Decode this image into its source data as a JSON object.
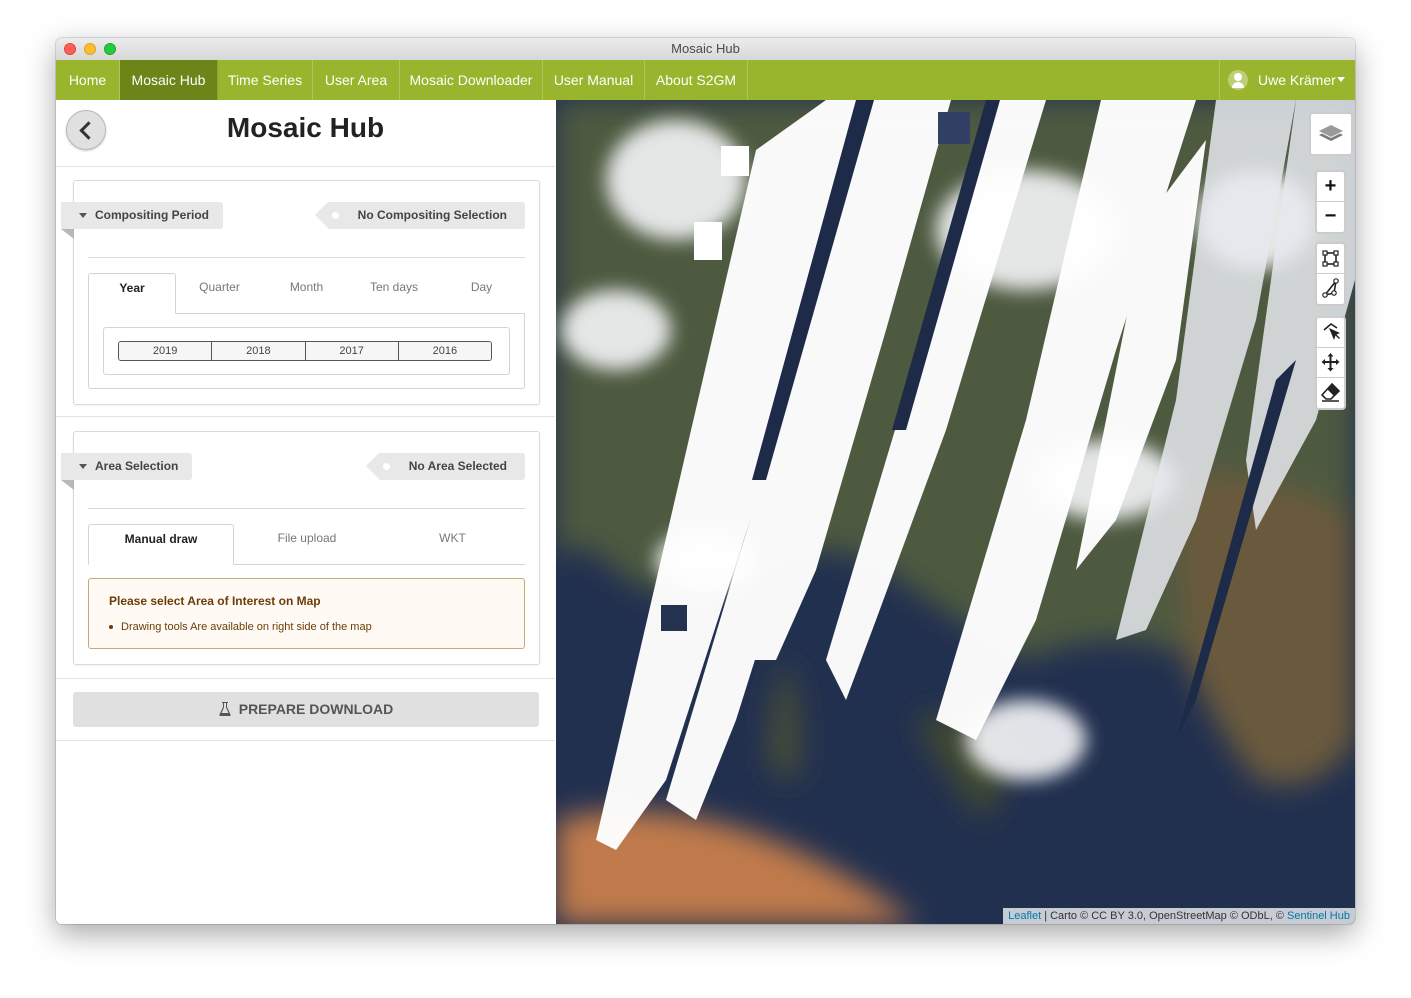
{
  "window": {
    "title": "Mosaic Hub"
  },
  "nav": {
    "items": [
      {
        "label": "Home",
        "active": false
      },
      {
        "label": "Mosaic Hub",
        "active": true
      },
      {
        "label": "Time Series",
        "active": false
      },
      {
        "label": "User Area",
        "active": false
      },
      {
        "label": "Mosaic Downloader",
        "active": false
      },
      {
        "label": "User Manual",
        "active": false
      },
      {
        "label": "About S2GM",
        "active": false
      }
    ],
    "user_name": "Uwe Krämer",
    "brand_color": "#98b52d",
    "active_color": "#6d8419"
  },
  "panel": {
    "title": "Mosaic Hub",
    "compositing": {
      "label": "Compositing Period",
      "status": "No Compositing Selection",
      "tabs": [
        "Year",
        "Quarter",
        "Month",
        "Ten days",
        "Day"
      ],
      "active_tab": "Year",
      "years": [
        "2019",
        "2018",
        "2017",
        "2016"
      ]
    },
    "area": {
      "label": "Area Selection",
      "status": "No Area Selected",
      "tabs": [
        "Manual draw",
        "File upload",
        "WKT"
      ],
      "active_tab": "Manual draw",
      "notice_title": "Please select Area of Interest on Map",
      "notice_items": [
        "Drawing tools Are available on right side of the map"
      ]
    },
    "prepare_label": "PREPARE DOWNLOAD"
  },
  "map": {
    "controls": {
      "zoom_in": "+",
      "zoom_out": "−",
      "icons": [
        "layers-icon",
        "draw-rectangle-icon",
        "draw-polygon-icon",
        "edit-vertex-icon",
        "move-icon",
        "erase-icon"
      ]
    },
    "attribution": {
      "leaflet": "Leaflet",
      "middle": " | Carto © CC BY 3.0, OpenStreetMap © ODbL, © ",
      "sentinel": "Sentinel Hub"
    }
  }
}
